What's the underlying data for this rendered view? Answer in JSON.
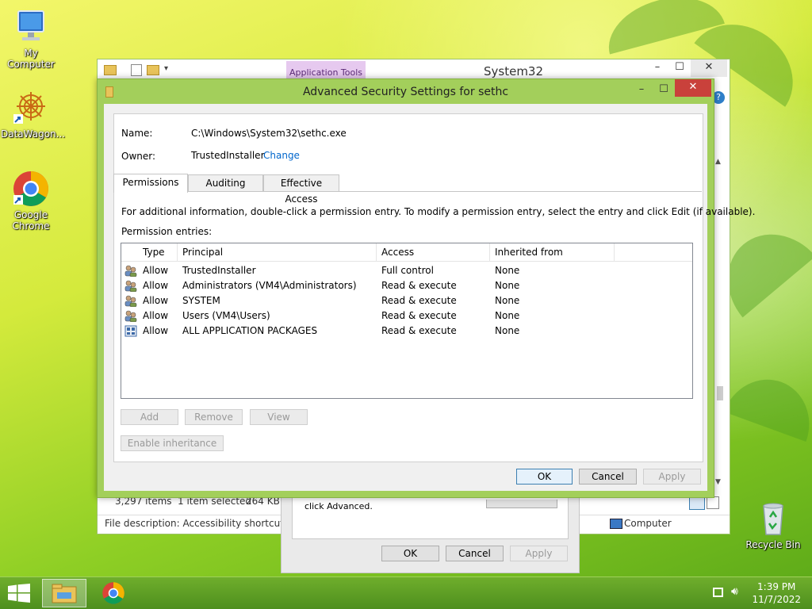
{
  "desktop": {
    "icons": [
      {
        "label": "My Computer",
        "icon": "computer-monitor-icon"
      },
      {
        "label": "DataWagon...",
        "icon": "mandala-shortcut-icon"
      },
      {
        "label": "Google Chrome",
        "icon": "chrome-icon"
      },
      {
        "label": "Recycle Bin",
        "icon": "recycle-bin-icon"
      }
    ]
  },
  "explorer": {
    "ribbon_tab": "Application Tools",
    "title": "System32",
    "status": {
      "items": "3,297 items",
      "selected": "1 item selected",
      "size": "264 KB",
      "description": "File description: Accessibility shortcut keys",
      "location": "Computer"
    }
  },
  "properties": {
    "hint": "click Advanced.",
    "ok": "OK",
    "cancel": "Cancel",
    "apply": "Apply"
  },
  "dialog": {
    "title": "Advanced Security Settings for sethc",
    "name_label": "Name:",
    "name_value": "C:\\Windows\\System32\\sethc.exe",
    "owner_label": "Owner:",
    "owner_value": "TrustedInstaller",
    "change_link": "Change",
    "tabs": [
      "Permissions",
      "Auditing",
      "Effective Access"
    ],
    "info": "For additional information, double-click a permission entry. To modify a permission entry, select the entry and click Edit (if available).",
    "entries_label": "Permission entries:",
    "columns": [
      "Type",
      "Principal",
      "Access",
      "Inherited from"
    ],
    "rows": [
      {
        "type": "Allow",
        "principal": "TrustedInstaller",
        "access": "Full control",
        "inherited": "None",
        "icon": "users-icon"
      },
      {
        "type": "Allow",
        "principal": "Administrators (VM4\\Administrators)",
        "access": "Read & execute",
        "inherited": "None",
        "icon": "users-icon"
      },
      {
        "type": "Allow",
        "principal": "SYSTEM",
        "access": "Read & execute",
        "inherited": "None",
        "icon": "users-icon"
      },
      {
        "type": "Allow",
        "principal": "Users (VM4\\Users)",
        "access": "Read & execute",
        "inherited": "None",
        "icon": "users-icon"
      },
      {
        "type": "Allow",
        "principal": "ALL APPLICATION PACKAGES",
        "access": "Read & execute",
        "inherited": "None",
        "icon": "app-packages-icon"
      }
    ],
    "add": "Add",
    "remove": "Remove",
    "view": "View",
    "enable_inheritance": "Enable inheritance",
    "ok": "OK",
    "cancel": "Cancel",
    "apply": "Apply"
  },
  "taskbar": {
    "time": "1:39 PM",
    "date": "11/7/2022"
  }
}
